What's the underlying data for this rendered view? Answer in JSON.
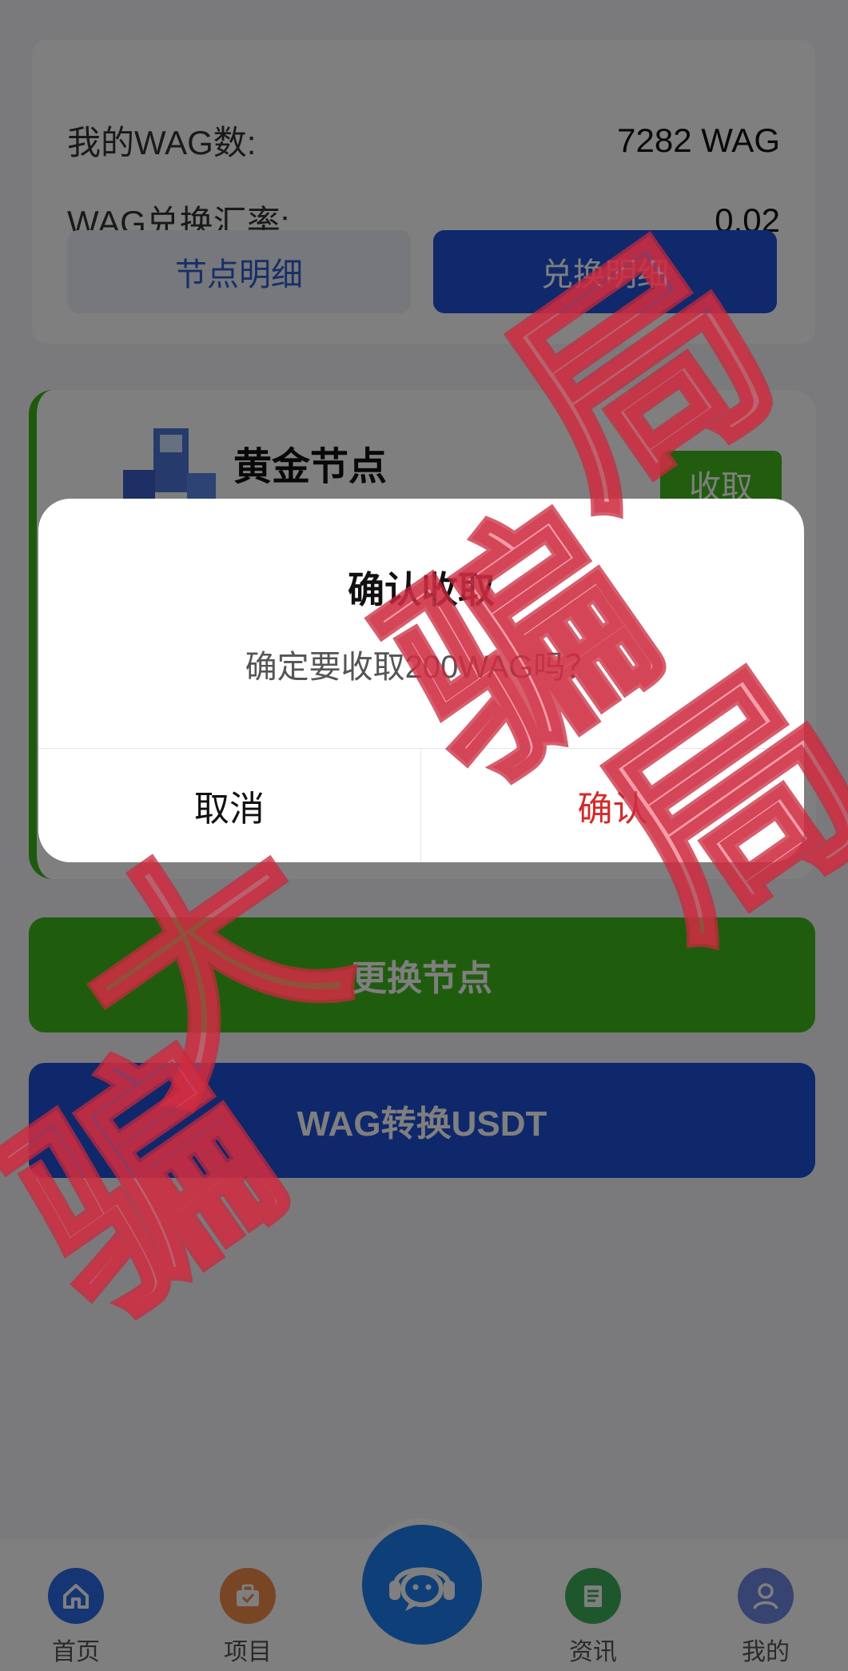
{
  "wallet": {
    "balance_label": "我的WAG数:",
    "balance_value": "7282 WAG",
    "rate_label": "WAG兑换汇率:",
    "rate_value": "0.02",
    "node_detail_label": "节点明细",
    "exchange_detail_label": "兑换明细"
  },
  "node": {
    "title": "黄金节点",
    "collect_label": "收取"
  },
  "actions": {
    "replace_label": "更换节点",
    "convert_label": "WAG转换USDT"
  },
  "nav": {
    "home": "首页",
    "project": "项目",
    "news": "资讯",
    "mine": "我的"
  },
  "dialog": {
    "title": "确认收取",
    "message": "确定要收取200WAG吗？",
    "cancel_label": "取消",
    "confirm_label": "确认"
  },
  "watermark": {
    "text": "大骗局骗局"
  },
  "colors": {
    "primary_blue": "#1f52d8",
    "accent_green": "#40b81c",
    "confirm_red": "#d42a2a",
    "watermark_red": "#ec4a60"
  }
}
